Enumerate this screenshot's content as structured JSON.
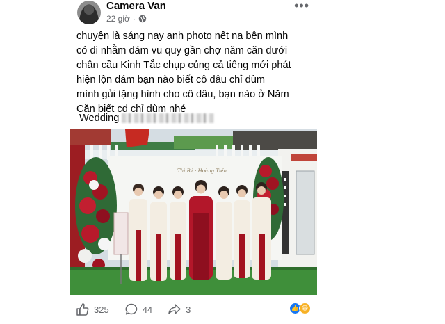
{
  "post": {
    "author": "Camera Van",
    "time": "22 giờ",
    "privacy_icon": "globe-icon",
    "more_icon": "ellipsis-icon",
    "text_lines": [
      "chuyện là sáng nay anh photo nết na bên mình",
      "có đi nhằm đám vu quy gần chợ năm căn dưới",
      "chân cầu Kinh Tắc chụp củng cả tiếng mới phát",
      "hiện lộn đám  bạn nào biết cô dâu chỉ dùm",
      "mình gủi tặng hình cho cô dâu, bạn nào ở Năm",
      "Căn biết cd chỉ dùm nhé"
    ],
    "wedding_label": "Wedding",
    "backdrop_text": "Thi Bé · Hoàng Tiến"
  },
  "actions": {
    "likes": "325",
    "comments": "44",
    "shares": "3"
  },
  "reactions": [
    "like-icon",
    "haha-icon"
  ],
  "colors": {
    "text": "#050505",
    "meta": "#65676b",
    "like_blue": "#1877f2",
    "ao_dai_white": "#f3ede2",
    "ao_dai_red": "#a3121f",
    "grass": "#3f8f3a"
  }
}
